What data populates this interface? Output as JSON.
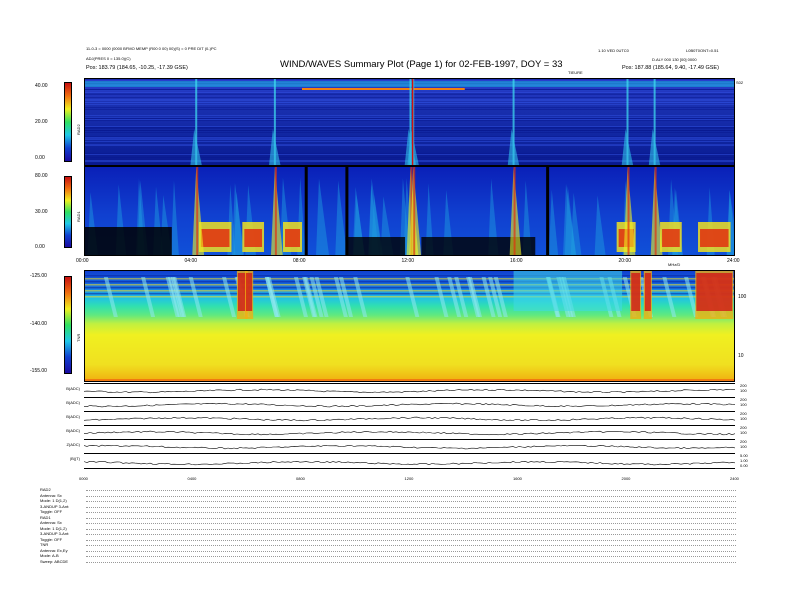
{
  "header": {
    "title": "WIND/WAVES Summary Plot (Page 1) for 02-FEB-1997, DOY = 33",
    "left_line1": "11-0-3 = 0000 (0000 BFMO MEMP (R00 0 00) 00)(S) = 0 PRE DIT (0-)PC",
    "left_line2": "ADJ(PRES 0 = 135.0)(C)",
    "left_pos": "Pos:    183.79 (184.65, -10.25, -17.39 GSE)",
    "right_line1": "1.10 VED 0UTC0",
    "right_line2": "L0B0T0ONT=0.51",
    "right_line3": "D.ALY 000 130 [00] 0000",
    "right_pos": "Pos:    187.88 (185.64, 9.40, -17.49 GSE)",
    "sublabel": "TIEURE",
    "page_num": "S02"
  },
  "panels": {
    "rad2": {
      "label": "RAD2",
      "ticks": [
        "40.00",
        "20.00",
        "0.00"
      ]
    },
    "rad1": {
      "label": "RAD1",
      "ticks": [
        "80.00",
        "30.00",
        "0.00"
      ]
    },
    "tnr": {
      "label": "TNR",
      "ticks": [
        "-125.00",
        "-140.00",
        "-155.00"
      ],
      "right_ticks": [
        "100",
        "10"
      ],
      "axis_note": "MHz/D"
    }
  },
  "time_ticks": [
    "00:00",
    "04:00",
    "08:00",
    "12:00",
    "16:00",
    "20:00",
    "24:00"
  ],
  "trace_time_ticks": [
    "0000",
    "0400",
    "0800",
    "1200",
    "1600",
    "2000",
    "2400"
  ],
  "traces": [
    {
      "label": "B(ADC)",
      "ticks": [
        "200",
        "100"
      ]
    },
    {
      "label": "B(ADC)",
      "ticks": [
        "200",
        "100"
      ]
    },
    {
      "label": "B(ADC)",
      "ticks": [
        "200",
        "100"
      ]
    },
    {
      "label": "B(ADC)",
      "ticks": [
        "200",
        "100"
      ]
    },
    {
      "label": "Z(ADC)",
      "ticks": [
        "200",
        "100"
      ]
    },
    {
      "label": "|B|(T)",
      "ticks": [
        "5.00",
        "1.00",
        "0.00"
      ]
    }
  ],
  "bottom_table": [
    "RAD2",
    "Antenna:      Sx",
    "Mode:      1 D(1,2)",
    "3-ANDUP 3-Ant:",
    "Toggle:      OFF",
    "RAD1",
    "Antenna:      Sx",
    "Mode:    1 D(1,2)",
    "3-ANDUP 3-Ant:",
    "Toggle:      OFF",
    "TNR",
    "Antenna:   Ex,Ey",
    "Mode:        A-B",
    "Sweep:   ABCDE"
  ],
  "chart_data": {
    "type": "heatmap",
    "title": "WIND/WAVES Summary Plot (Page 1) for 02-FEB-1997, DOY = 33",
    "x_range": [
      "00:00",
      "24:00"
    ],
    "panels": [
      "RAD2",
      "RAD1",
      "TNR"
    ],
    "colors": {
      "low": "#0a1e9a",
      "mid": "#1fd3e8",
      "high": "#f0f020",
      "max": "#d21010"
    },
    "burst_hours": [
      4.1,
      7.0,
      12.0,
      12.1,
      15.8,
      20.0,
      21.0
    ],
    "gap_hours": [
      8.1,
      9.6,
      17.0
    ]
  }
}
